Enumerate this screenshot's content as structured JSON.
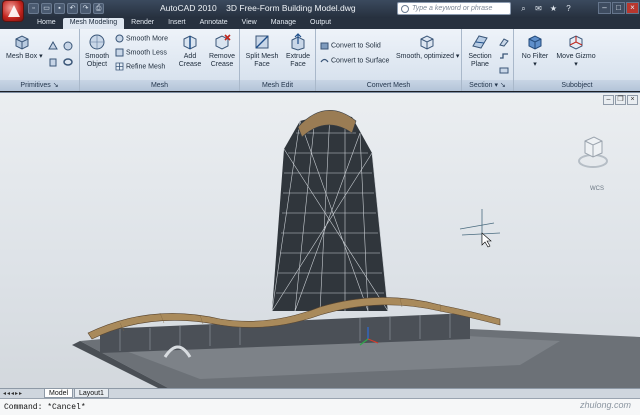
{
  "title_bar": {
    "app_name": "AutoCAD 2010",
    "document": "3D Free-Form Building Model.dwg",
    "search_placeholder": "Type a keyword or phrase",
    "help": "?"
  },
  "quick_access": [
    "new-icon",
    "open-icon",
    "save-icon",
    "undo-icon",
    "redo-icon",
    "plot-icon"
  ],
  "tabs": [
    "Home",
    "Mesh Modeling",
    "Render",
    "Insert",
    "Annotate",
    "View",
    "Manage",
    "Output"
  ],
  "active_tab": "Mesh Modeling",
  "ribbon": {
    "primitives": {
      "title": "Primitives",
      "mesh_box": "Mesh Box"
    },
    "mesh": {
      "title": "Mesh",
      "smooth_object": "Smooth Object",
      "smooth_more": "Smooth More",
      "smooth_less": "Smooth Less",
      "refine_mesh": "Refine Mesh",
      "add_crease": "Add Crease",
      "remove_crease": "Remove Crease"
    },
    "mesh_edit": {
      "title": "Mesh Edit",
      "split_mesh_face": "Split Mesh Face",
      "extrude_face": "Extrude Face"
    },
    "convert_mesh": {
      "title": "Convert Mesh",
      "convert_to_solid": "Convert to Solid",
      "convert_to_surface": "Convert to Surface",
      "smooth_optimized": "Smooth, optimized"
    },
    "section": {
      "title": "Section",
      "section_plane": "Section Plane"
    },
    "subobject": {
      "title": "Subobject",
      "no_filter": "No Filter",
      "move_gizmo": "Move Gizmo"
    }
  },
  "viewport": {
    "viewcube_label": "WCS",
    "colors": {
      "background": "#e4e8ec",
      "structure": "#2c3136",
      "roof": "#a88a5c",
      "base": "#6d7278"
    }
  },
  "layout_tabs": [
    "Model",
    "Layout1"
  ],
  "active_layout": "Model",
  "command_line": "Command: *Cancel*",
  "watermark": "zhulong.com"
}
